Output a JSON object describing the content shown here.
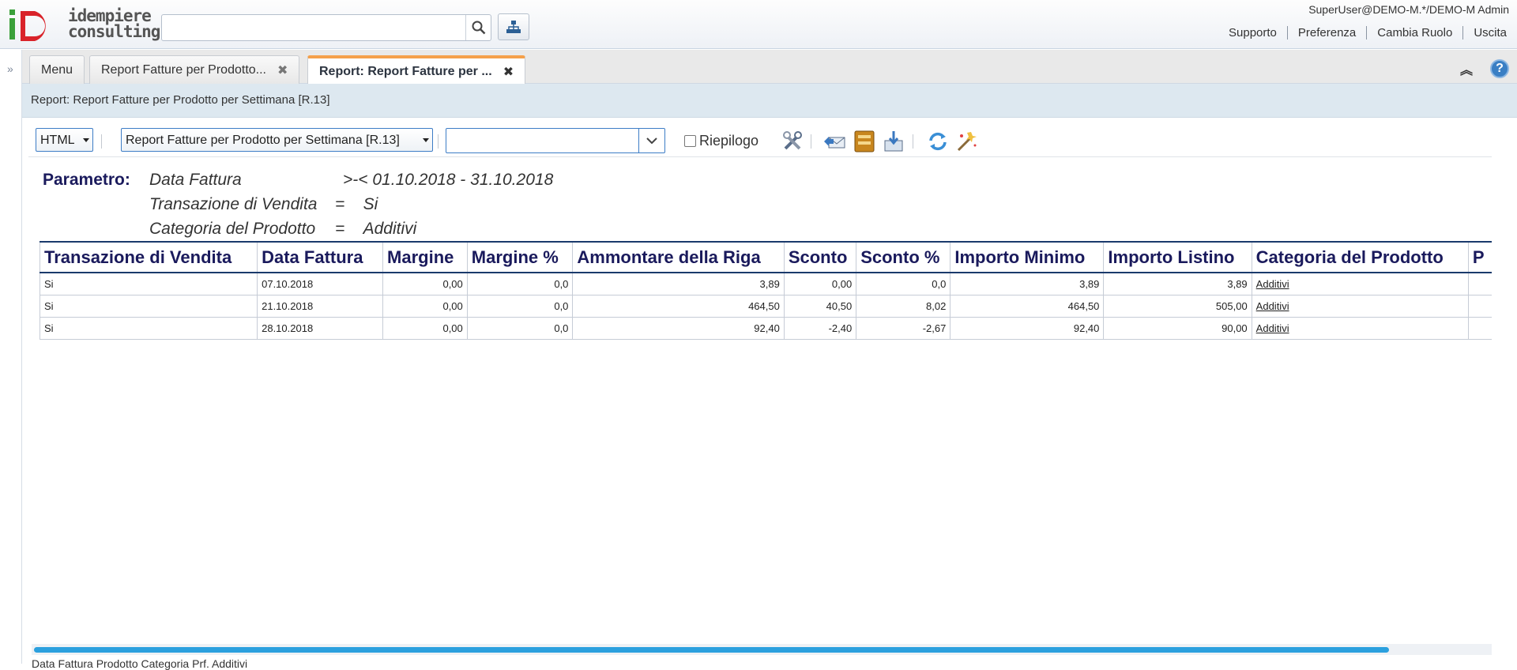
{
  "app": {
    "logo_top": "idempiere",
    "logo_bottom": "consulting"
  },
  "header": {
    "search_placeholder": "",
    "user": "SuperUser@DEMO-M.*/DEMO-M Admin",
    "links": [
      "Supporto",
      "Preferenza",
      "Cambia Ruolo",
      "Uscita"
    ]
  },
  "tabs": [
    {
      "label": "Menu"
    },
    {
      "label": "Report Fatture per Prodotto...",
      "closable": true
    },
    {
      "label": "Report: Report Fatture per ...",
      "closable": true,
      "active": true
    }
  ],
  "title": "Report: Report Fatture per Prodotto per Settimana [R.13]",
  "toolbar": {
    "format": "HTML",
    "report": "Report Fatture per Prodotto per Settimana [R.13]",
    "combo_value": "",
    "summary_label": "Riepilogo",
    "summary_checked": false
  },
  "params": {
    "label": "Parametro:",
    "rows": [
      {
        "name": "Data Fattura",
        "op": ">-<",
        "value": "01.10.2018 - 31.10.2018"
      },
      {
        "name": "Transazione di Vendita",
        "op": "=",
        "value": "Si"
      },
      {
        "name": "Categoria del Prodotto",
        "op": "=",
        "value": "Additivi"
      }
    ]
  },
  "table": {
    "columns": [
      "Transazione di Vendita",
      "Data Fattura",
      "Margine",
      "Margine %",
      "Ammontare della Riga",
      "Sconto",
      "Sconto %",
      "Importo Minimo",
      "Importo Listino",
      "Categoria del Prodotto",
      "P"
    ],
    "rows": [
      [
        "Si",
        "07.10.2018",
        "0,00",
        "0,0",
        "3,89",
        "0,00",
        "0,0",
        "3,89",
        "3,89",
        "Additivi",
        ""
      ],
      [
        "Si",
        "21.10.2018",
        "0,00",
        "0,0",
        "464,50",
        "40,50",
        "8,02",
        "464,50",
        "505,00",
        "Additivi",
        ""
      ],
      [
        "Si",
        "28.10.2018",
        "0,00",
        "0,0",
        "92,40",
        "-2,40",
        "-2,67",
        "92,40",
        "90,00",
        "Additivi",
        ""
      ]
    ]
  },
  "footer": "Data Fattura     Prodotto     Categoria     Prf. Additivi",
  "colors": {
    "accent": "#f5a04a",
    "header_text": "#1a1a5c",
    "link_blue": "#3d7dc6",
    "scroll": "#2ba0de"
  }
}
